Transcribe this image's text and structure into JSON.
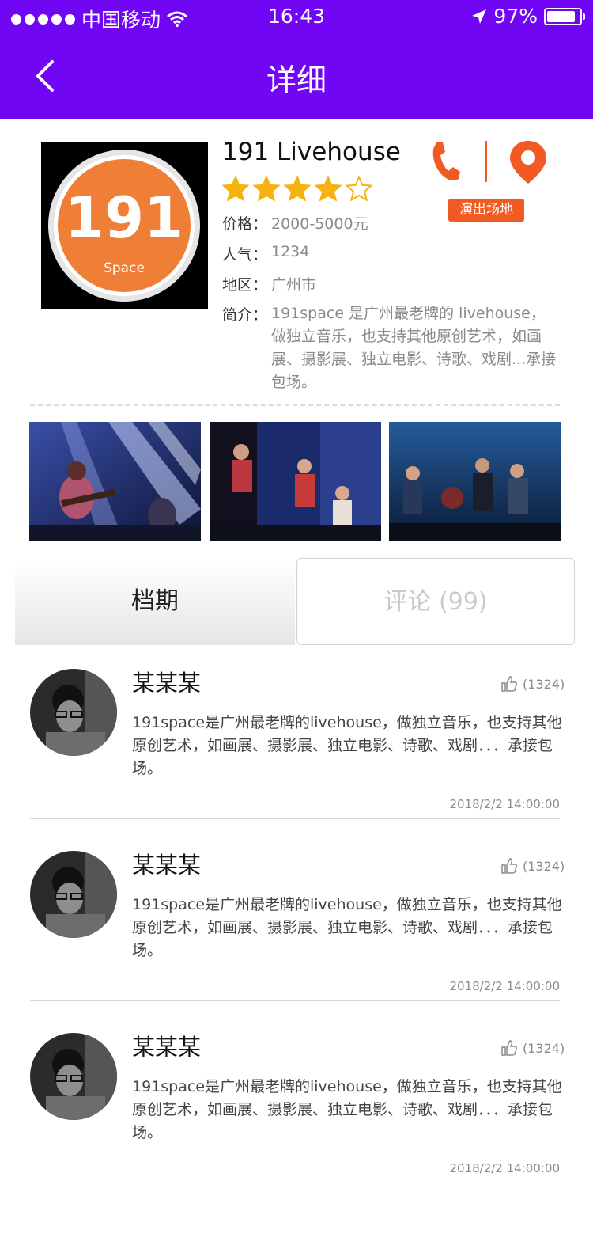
{
  "status_bar": {
    "carrier": "中国移动",
    "time": "16:43",
    "battery": "97%",
    "battery_level": 0.97
  },
  "header": {
    "title": "详细"
  },
  "venue": {
    "name": "191 Livehouse",
    "logo_text": "191",
    "logo_subtext": "Space",
    "rating": 4,
    "rating_max": 5,
    "price_label": "价格：",
    "price": "2000-5000元",
    "popularity_label": "人气：",
    "popularity": "1234",
    "area_label": "地区：",
    "area": "广州市",
    "intro_label": "简介：",
    "intro": "191space 是广州最老牌的 livehouse，做独立音乐，也支持其他原创艺术，如画展、摄影展、独立电影、诗歌、戏剧...承接包场。",
    "badge": "演出场地",
    "colors": {
      "accent": "#f25a24",
      "header": "#7006f3",
      "star": "#f6b30f"
    }
  },
  "tabs": [
    {
      "label": "档期",
      "active": true
    },
    {
      "label": "评论 (99)",
      "active": false
    }
  ],
  "comments": [
    {
      "user": "某某某",
      "likes": "(1324)",
      "text": "191space是广州最老牌的livehouse，做独立音乐，也支持其他原创艺术，如画展、摄影展、独立电影、诗歌、戏剧．．．承接包场。",
      "time": "2018/2/2 14:00:00"
    },
    {
      "user": "某某某",
      "likes": "(1324)",
      "text": "191space是广州最老牌的livehouse，做独立音乐，也支持其他原创艺术，如画展、摄影展、独立电影、诗歌、戏剧．．．承接包场。",
      "time": "2018/2/2 14:00:00"
    },
    {
      "user": "某某某",
      "likes": "(1324)",
      "text": "191space是广州最老牌的livehouse，做独立音乐，也支持其他原创艺术，如画展、摄影展、独立电影、诗歌、戏剧．．．承接包场。",
      "time": "2018/2/2 14:00:00"
    }
  ]
}
